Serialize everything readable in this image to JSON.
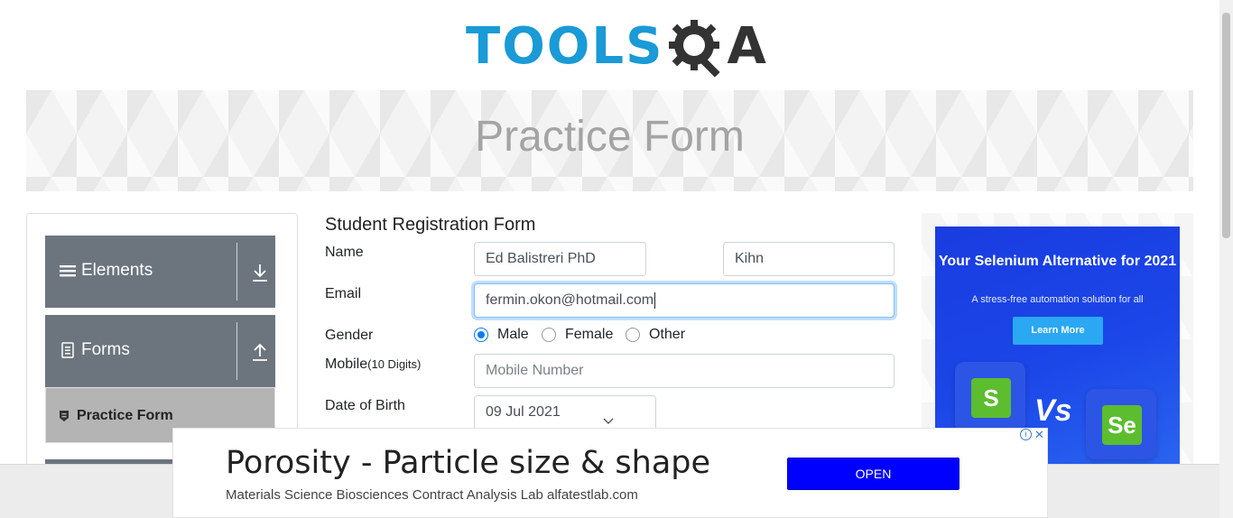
{
  "logo": {
    "text_main": "TOOLS",
    "text_end": "A"
  },
  "banner": {
    "title": "Practice Form"
  },
  "sidebar": {
    "groups": [
      {
        "label": "Elements",
        "icon": "list-icon",
        "toggle": "download-arrow-icon"
      },
      {
        "label": "Forms",
        "icon": "document-icon",
        "toggle": "upload-arrow-icon"
      }
    ],
    "active_item": {
      "label": "Practice Form",
      "icon": "shield-document-icon"
    }
  },
  "form": {
    "title": "Student Registration Form",
    "name_label": "Name",
    "first_name_value": "Ed Balistreri PhD",
    "last_name_value": "Kihn",
    "email_label": "Email",
    "email_value": "fermin.okon@hotmail.com",
    "gender_label": "Gender",
    "gender_options": [
      "Male",
      "Female",
      "Other"
    ],
    "gender_selected": "Male",
    "mobile_label": "Mobile",
    "mobile_hint": "(10 Digits)",
    "mobile_placeholder": "Mobile Number",
    "dob_label": "Date of Birth",
    "dob_value": "09 Jul 2021"
  },
  "side_ad": {
    "headline": "Your Selenium Alternative for 2021",
    "subline": "A stress-free automation solution for all",
    "button": "Learn More",
    "vs_text": "Vs",
    "left_logo_letter": "S",
    "right_logo_letter": "Se"
  },
  "bottom_ad": {
    "title": "Porosity - Particle size & shape",
    "subtitle": "Materials Science Biosciences Contract Analysis Lab alfatestlab.com",
    "button": "OPEN"
  },
  "colors": {
    "accent": "#007bff",
    "sidebar_header": "#6c757d",
    "active_item": "#b4b4b4",
    "logo_blue": "#1a9ad6",
    "ad_button": "#0000ff"
  }
}
